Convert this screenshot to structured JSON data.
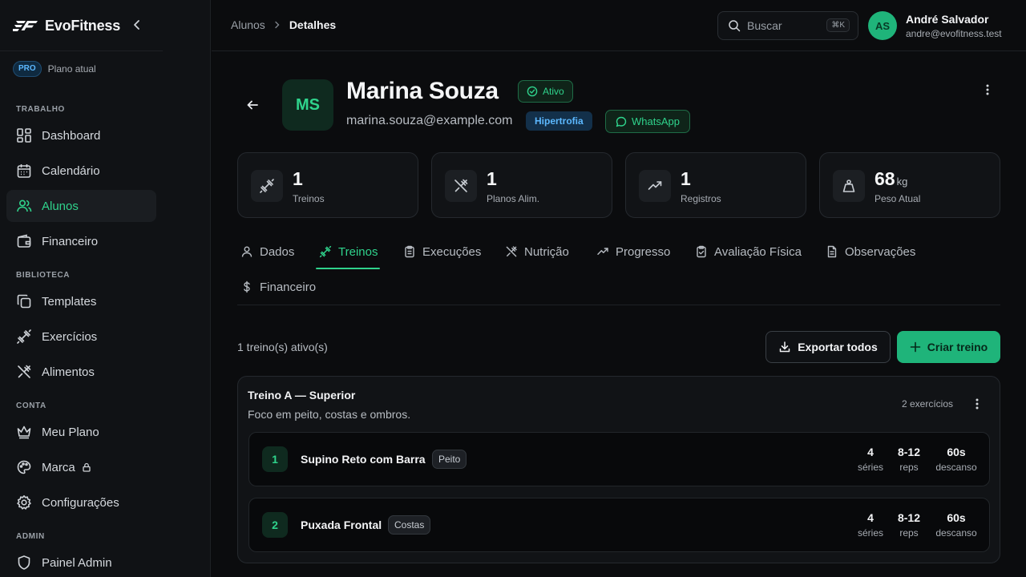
{
  "brand": {
    "name": "EvoFitness",
    "accent": "#1fb47a"
  },
  "plan": {
    "badge": "PRO",
    "label": "Plano atual"
  },
  "sidebar": {
    "sections": [
      {
        "title": "TRABALHO"
      },
      {
        "title": "BIBLIOTECA"
      },
      {
        "title": "CONTA"
      },
      {
        "title": "ADMIN"
      }
    ],
    "items": [
      {
        "label": "Dashboard",
        "icon": "dashboard-icon"
      },
      {
        "label": "Calendário",
        "icon": "calendar-icon"
      },
      {
        "label": "Alunos",
        "icon": "users-icon",
        "active": true
      },
      {
        "label": "Financeiro",
        "icon": "wallet-icon"
      },
      {
        "label": "Templates",
        "icon": "copy-icon"
      },
      {
        "label": "Exercícios",
        "icon": "dumbbell-icon"
      },
      {
        "label": "Alimentos",
        "icon": "utensils-icon"
      },
      {
        "label": "Meu Plano",
        "icon": "crown-icon"
      },
      {
        "label": "Marca",
        "icon": "palette-icon",
        "locked": true
      },
      {
        "label": "Configurações",
        "icon": "gear-icon"
      },
      {
        "label": "Painel Admin",
        "icon": "shield-icon"
      }
    ]
  },
  "header": {
    "breadcrumb": [
      "Alunos",
      "Detalhes"
    ],
    "search": {
      "placeholder": "Buscar",
      "shortcut": "⌘K"
    },
    "user": {
      "initials": "AS",
      "name": "André Salvador",
      "email": "andre@evofitness.test"
    }
  },
  "student": {
    "initials": "MS",
    "name": "Marina Souza",
    "status": "Ativo",
    "email": "marina.souza@example.com",
    "goal": "Hipertrofia",
    "whatsapp": "WhatsApp"
  },
  "stats": [
    {
      "value": "1",
      "unit": "",
      "label": "Treinos",
      "icon": "dumbbell-icon"
    },
    {
      "value": "1",
      "unit": "",
      "label": "Planos Alim.",
      "icon": "utensils-icon"
    },
    {
      "value": "1",
      "unit": "",
      "label": "Registros",
      "icon": "trending-up-icon"
    },
    {
      "value": "68",
      "unit": "kg",
      "label": "Peso Atual",
      "icon": "weight-icon"
    }
  ],
  "tabs": [
    {
      "label": "Dados",
      "icon": "user-icon"
    },
    {
      "label": "Treinos",
      "icon": "dumbbell-icon",
      "active": true
    },
    {
      "label": "Execuções",
      "icon": "clipboard-icon"
    },
    {
      "label": "Nutrição",
      "icon": "utensils-icon"
    },
    {
      "label": "Progresso",
      "icon": "trending-up-icon"
    },
    {
      "label": "Avaliação Física",
      "icon": "clipboard-check-icon"
    },
    {
      "label": "Observações",
      "icon": "file-text-icon"
    },
    {
      "label": "Financeiro",
      "icon": "dollar-icon"
    }
  ],
  "workouts": {
    "count_text": "1 treino(s) ativo(s)",
    "export_label": "Exportar todos",
    "create_label": "Criar treino",
    "items": [
      {
        "title": "Treino A — Superior",
        "description": "Foco em peito, costas e ombros.",
        "exercise_count": "2 exercícios",
        "exercises": [
          {
            "num": "1",
            "name": "Supino Reto com Barra",
            "tag": "Peito",
            "sets": "4",
            "sets_label": "séries",
            "reps": "8-12",
            "reps_label": "reps",
            "rest": "60s",
            "rest_label": "descanso"
          },
          {
            "num": "2",
            "name": "Puxada Frontal",
            "tag": "Costas",
            "sets": "4",
            "sets_label": "séries",
            "reps": "8-12",
            "reps_label": "reps",
            "rest": "60s",
            "rest_label": "descanso"
          }
        ]
      }
    ]
  }
}
